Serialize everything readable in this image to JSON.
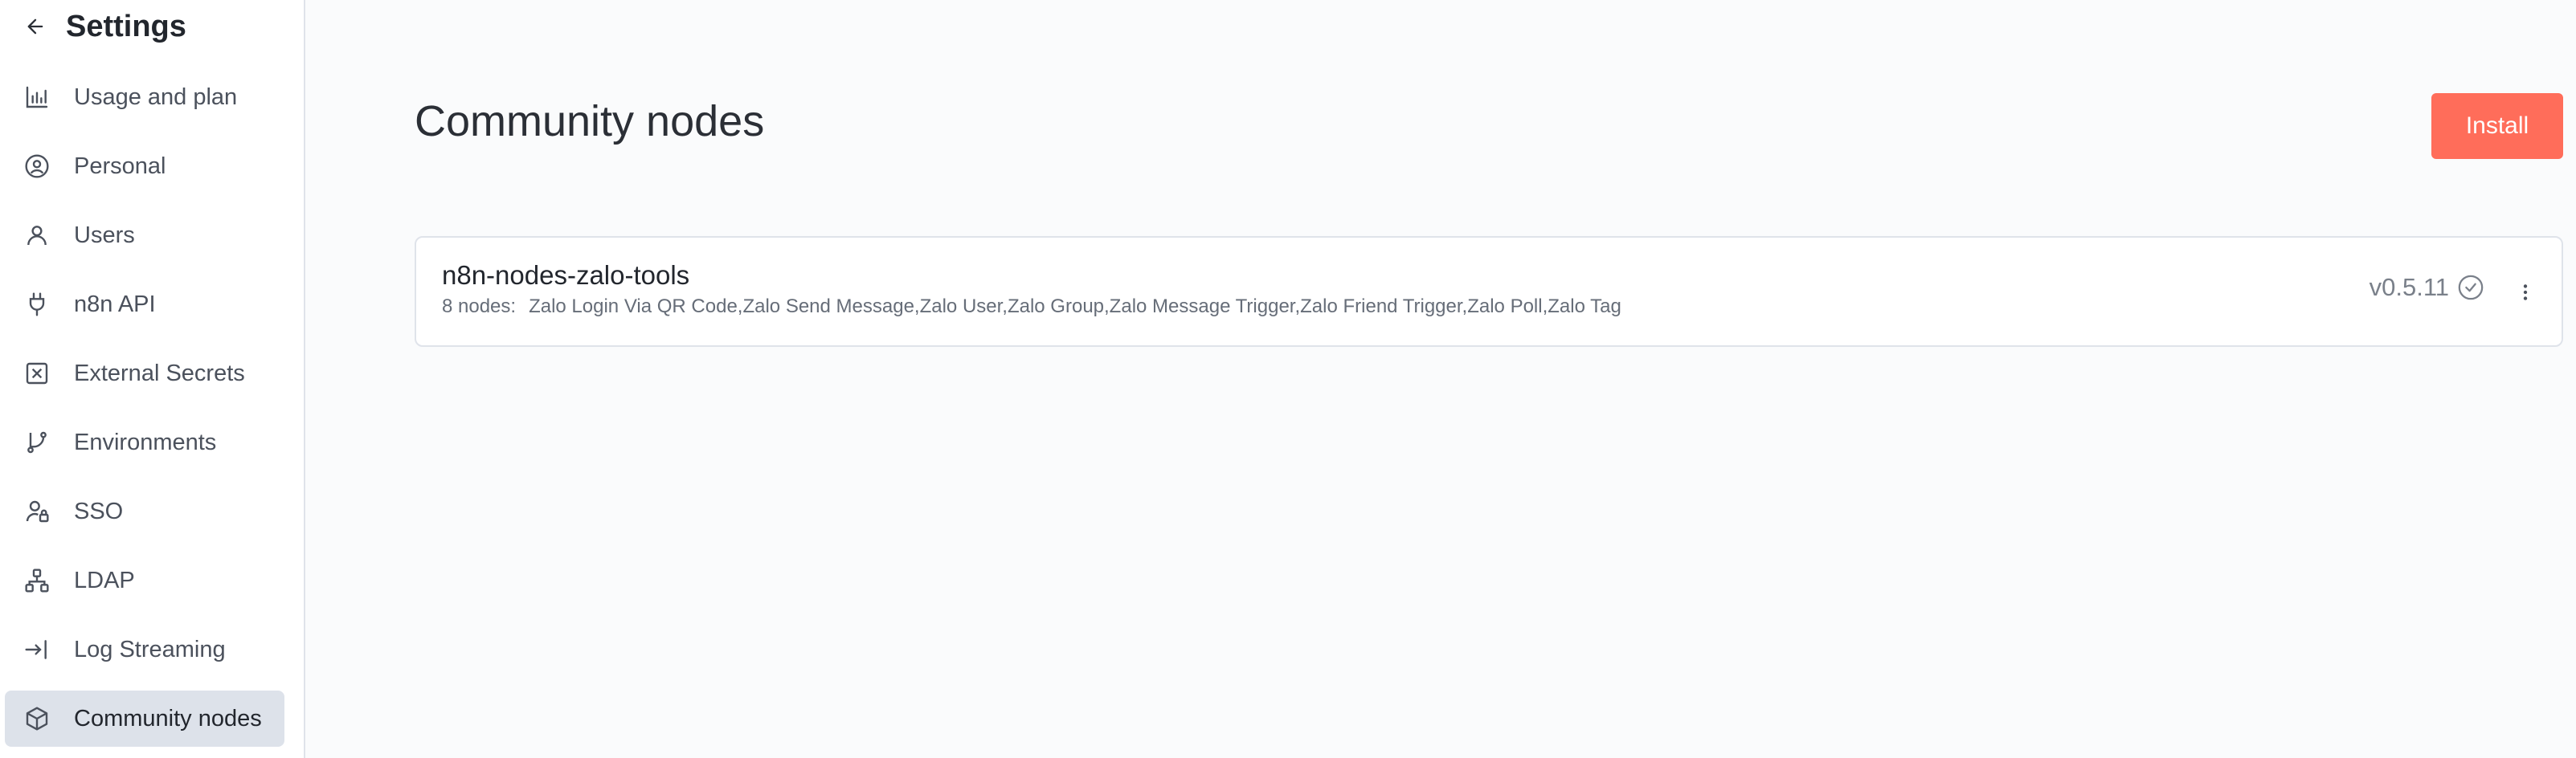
{
  "sidebar": {
    "title": "Settings",
    "items": [
      {
        "label": "Usage and plan",
        "icon": "bar-chart-icon"
      },
      {
        "label": "Personal",
        "icon": "user-circle-icon"
      },
      {
        "label": "Users",
        "icon": "user-icon"
      },
      {
        "label": "n8n API",
        "icon": "plug-icon"
      },
      {
        "label": "External Secrets",
        "icon": "vault-icon"
      },
      {
        "label": "Environments",
        "icon": "git-branch-icon"
      },
      {
        "label": "SSO",
        "icon": "user-lock-icon"
      },
      {
        "label": "LDAP",
        "icon": "network-icon"
      },
      {
        "label": "Log Streaming",
        "icon": "log-in-icon"
      },
      {
        "label": "Community nodes",
        "icon": "box-icon",
        "active": true
      }
    ]
  },
  "main": {
    "title": "Community nodes",
    "install_label": "Install",
    "package": {
      "name": "n8n-nodes-zalo-tools",
      "nodes_count": "8 nodes:",
      "nodes_list": "Zalo Login Via QR Code,Zalo Send Message,Zalo User,Zalo Group,Zalo Message Trigger,Zalo Friend Trigger,Zalo Poll,Zalo Tag",
      "version": "v0.5.11"
    }
  },
  "colors": {
    "accent": "#ff6d5a",
    "active_bg": "#dde2ea",
    "sidebar_bg": "#ffffff",
    "main_bg": "#fafbfc"
  }
}
